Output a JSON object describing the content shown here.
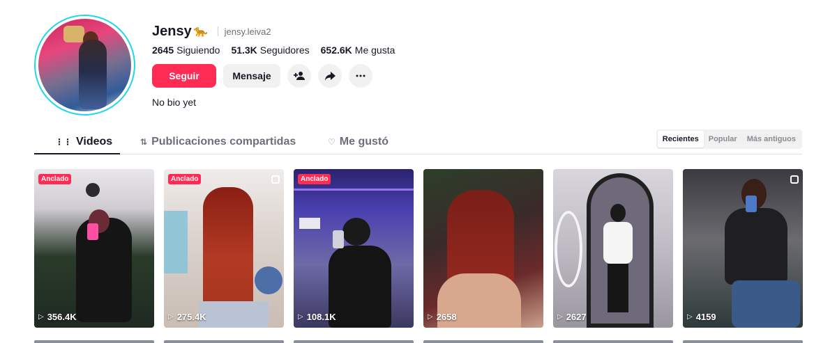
{
  "profile": {
    "username": "Jensy",
    "username_emoji": "🐆",
    "handle": "jensy.leiva2",
    "stats": [
      {
        "value": "2645",
        "label": "Siguiendo"
      },
      {
        "value": "51.3K",
        "label": "Seguidores"
      },
      {
        "value": "652.6K",
        "label": "Me gusta"
      }
    ],
    "bio": "No bio yet"
  },
  "actions": {
    "follow_label": "Seguir",
    "message_label": "Mensaje",
    "icons": [
      "add-friend-icon",
      "share-icon",
      "more-icon"
    ]
  },
  "tabs": [
    {
      "label": "Videos",
      "icon": "grid-icon",
      "active": true
    },
    {
      "label": "Publicaciones compartidas",
      "icon": "repost-icon",
      "active": false
    },
    {
      "label": "Me gustó",
      "icon": "heart-outline-icon",
      "active": false
    }
  ],
  "sort": {
    "options": [
      "Recientes",
      "Popular",
      "Más antiguos"
    ],
    "selected": "Recientes"
  },
  "videos": [
    {
      "views": "356.4K",
      "pinned_label": "Anclado",
      "multi": false
    },
    {
      "views": "275.4K",
      "pinned_label": "Anclado",
      "multi": true
    },
    {
      "views": "108.1K",
      "pinned_label": "Anclado",
      "multi": false
    },
    {
      "views": "2658",
      "pinned_label": "",
      "multi": false
    },
    {
      "views": "2627",
      "pinned_label": "",
      "multi": false
    },
    {
      "views": "4159",
      "pinned_label": "",
      "multi": true
    }
  ],
  "colors": {
    "accent": "#fe2c55",
    "avatar_ring": "#20d5ec",
    "text": "#161823"
  }
}
